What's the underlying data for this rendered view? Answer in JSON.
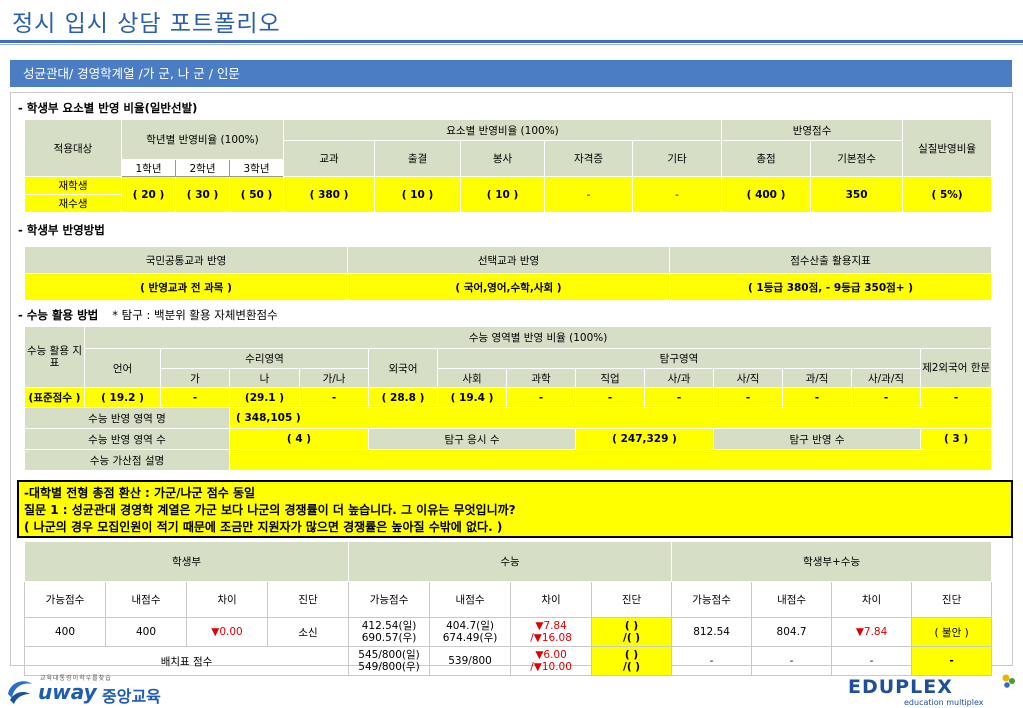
{
  "page_title": "정시 입시 상담 포트폴리오",
  "section_title": "성균관대/ 경영학계열 /가 군, 나 군 / 인문",
  "t1": {
    "heading": "- 학생부 요소별 반영 비율(일반선발)",
    "h_target": "적용대상",
    "h_grade_ratio": "학년별 반영비율 (100%)",
    "h_g1": "1학년",
    "h_g2": "2학년",
    "h_g3": "3학년",
    "h_element_ratio": "요소별 반영비율 (100%)",
    "h_subject": "교과",
    "h_attend": "출결",
    "h_volunteer": "봉사",
    "h_cert": "자격증",
    "h_etc": "기타",
    "h_score": "반영점수",
    "h_total": "총점",
    "h_base": "기본점수",
    "h_real": "실질반영비율",
    "target1": "재학생",
    "target2": "재수생",
    "v_g1": "( 20 )",
    "v_g2": "( 30 )",
    "v_g3": "( 50 )",
    "v_subject": "( 380 )",
    "v_attend": "( 10 )",
    "v_volunteer": "( 10 )",
    "v_cert": "-",
    "v_etc": "-",
    "v_total": "( 400 )",
    "v_base": "350",
    "v_real": "( 5%)"
  },
  "t2": {
    "heading": "- 학생부 반영방법",
    "h_common": "국민공통교과 반영",
    "h_elective": "선택교과 반영",
    "h_index": "점수산출 활용지표",
    "v_common": "( 반영교과 전 과목 )",
    "v_elective": "( 국어,영어,수학,사회 )",
    "v_index": "( 1등급 380점, - 9등급 350점+ )"
  },
  "t3": {
    "heading": "- 수능 활용 방법",
    "note": "* 탐구 : 백분위 활용 자체변환점수",
    "h_index": "수능 활용 지표",
    "h_kor": "언어",
    "h_math": "수리영역",
    "h_math_ga": "가",
    "h_math_na": "나",
    "h_math_gana": "가/나",
    "h_ratio": "수능 영역별 반영 비율 (100%)",
    "h_eng": "외국어",
    "h_tamgu": "탐구영역",
    "h_soc": "사회",
    "h_sci": "과학",
    "h_job": "직업",
    "h_sg": "사/과",
    "h_sj": "사/직",
    "h_gj": "과/직",
    "h_sgj": "사/과/직",
    "h_second": "제2외국어 한문",
    "v_index": "(표준점수 )",
    "v_kor": "( 19.2 )",
    "v_ga": "-",
    "v_na": "(29.1 )",
    "v_gana": "-",
    "v_eng": "( 28.8 )",
    "v_soc": "( 19.4 )",
    "v_sci": "-",
    "v_job": "-",
    "v_sg": "-",
    "v_sj": "-",
    "v_gj": "-",
    "v_sgj": "-",
    "v_second": "-",
    "l_area_name": "수능 반영 영역 명",
    "v_area_name": "( 348,105 )",
    "l_area_count": "수능 반영 영역 수",
    "v_area_count": "( 4 )",
    "l_tamgu_count": "탐구 응시 수",
    "v_tamgu_count": "( 247,329 )",
    "l_tamgu_reflect": "탐구 반영 수",
    "v_tamgu_reflect": "( 3 )",
    "l_bonus": "수능 가산점 설명",
    "v_bonus": ""
  },
  "question": {
    "line1": "-대학별 전형 총점 환산 : 가군/나군 점수 동일",
    "line2": "질문 1 : 성균관대 경영학 계열은 가군 보다 나군의 경쟁률이 더 높습니다. 그 이유는 무엇입니까?",
    "line3": "( 나군의 경우 모집인원이 적기 때문에 조금만 지원자가 많으면 경쟁률은 높아질 수밖에 없다. )"
  },
  "t4": {
    "h_student": "학생부",
    "h_suneung": "수능",
    "h_both": "학생부+수능",
    "h_possible": "가능점수",
    "h_mine": "내점수",
    "h_diff": "차이",
    "h_diag": "진단",
    "r1_possible": "400",
    "r1_mine": "400",
    "r1_diff": "▼0.00",
    "r1_diag": "소신",
    "r1_s_possible_1": "412.54(일)",
    "r1_s_possible_2": "690.57(우)",
    "r1_s_mine_1": "404.7(일)",
    "r1_s_mine_2": "674.49(우)",
    "r1_s_diff_1": "▼7.84",
    "r1_s_diff_2": "/▼16.08",
    "r1_s_diag_1": "( )",
    "r1_s_diag_2": "/( )",
    "r1_b_possible": "812.54",
    "r1_b_mine": "804.7",
    "r1_b_diff": "▼7.84",
    "r1_b_diag": "( 불안 )",
    "r2_label": "배치표 점수",
    "r2_s_possible_1": "545/800(일)",
    "r2_s_possible_2": "549/800(우)",
    "r2_s_mine": "539/800",
    "r2_s_diff_1": "▼6.00",
    "r2_s_diff_2": "/▼10.00",
    "r2_s_diag_1": "( )",
    "r2_s_diag_2": "/( )",
    "r2_b_possible": "-",
    "r2_b_mine": "-",
    "r2_b_diff": "-",
    "r2_b_diag": "-"
  },
  "footer": {
    "left_small": "교육대통령이학우를찾습",
    "left_brand": "uway",
    "left_name": "중앙교육",
    "right_brand": "EDUPLEX",
    "right_sub": "education multiplex"
  },
  "colors": {
    "title": "#2b5fae",
    "bar": "#4a7dc3",
    "header_cell": "#d6dec6",
    "value_cell": "#ffff00",
    "down": "#e00000"
  }
}
